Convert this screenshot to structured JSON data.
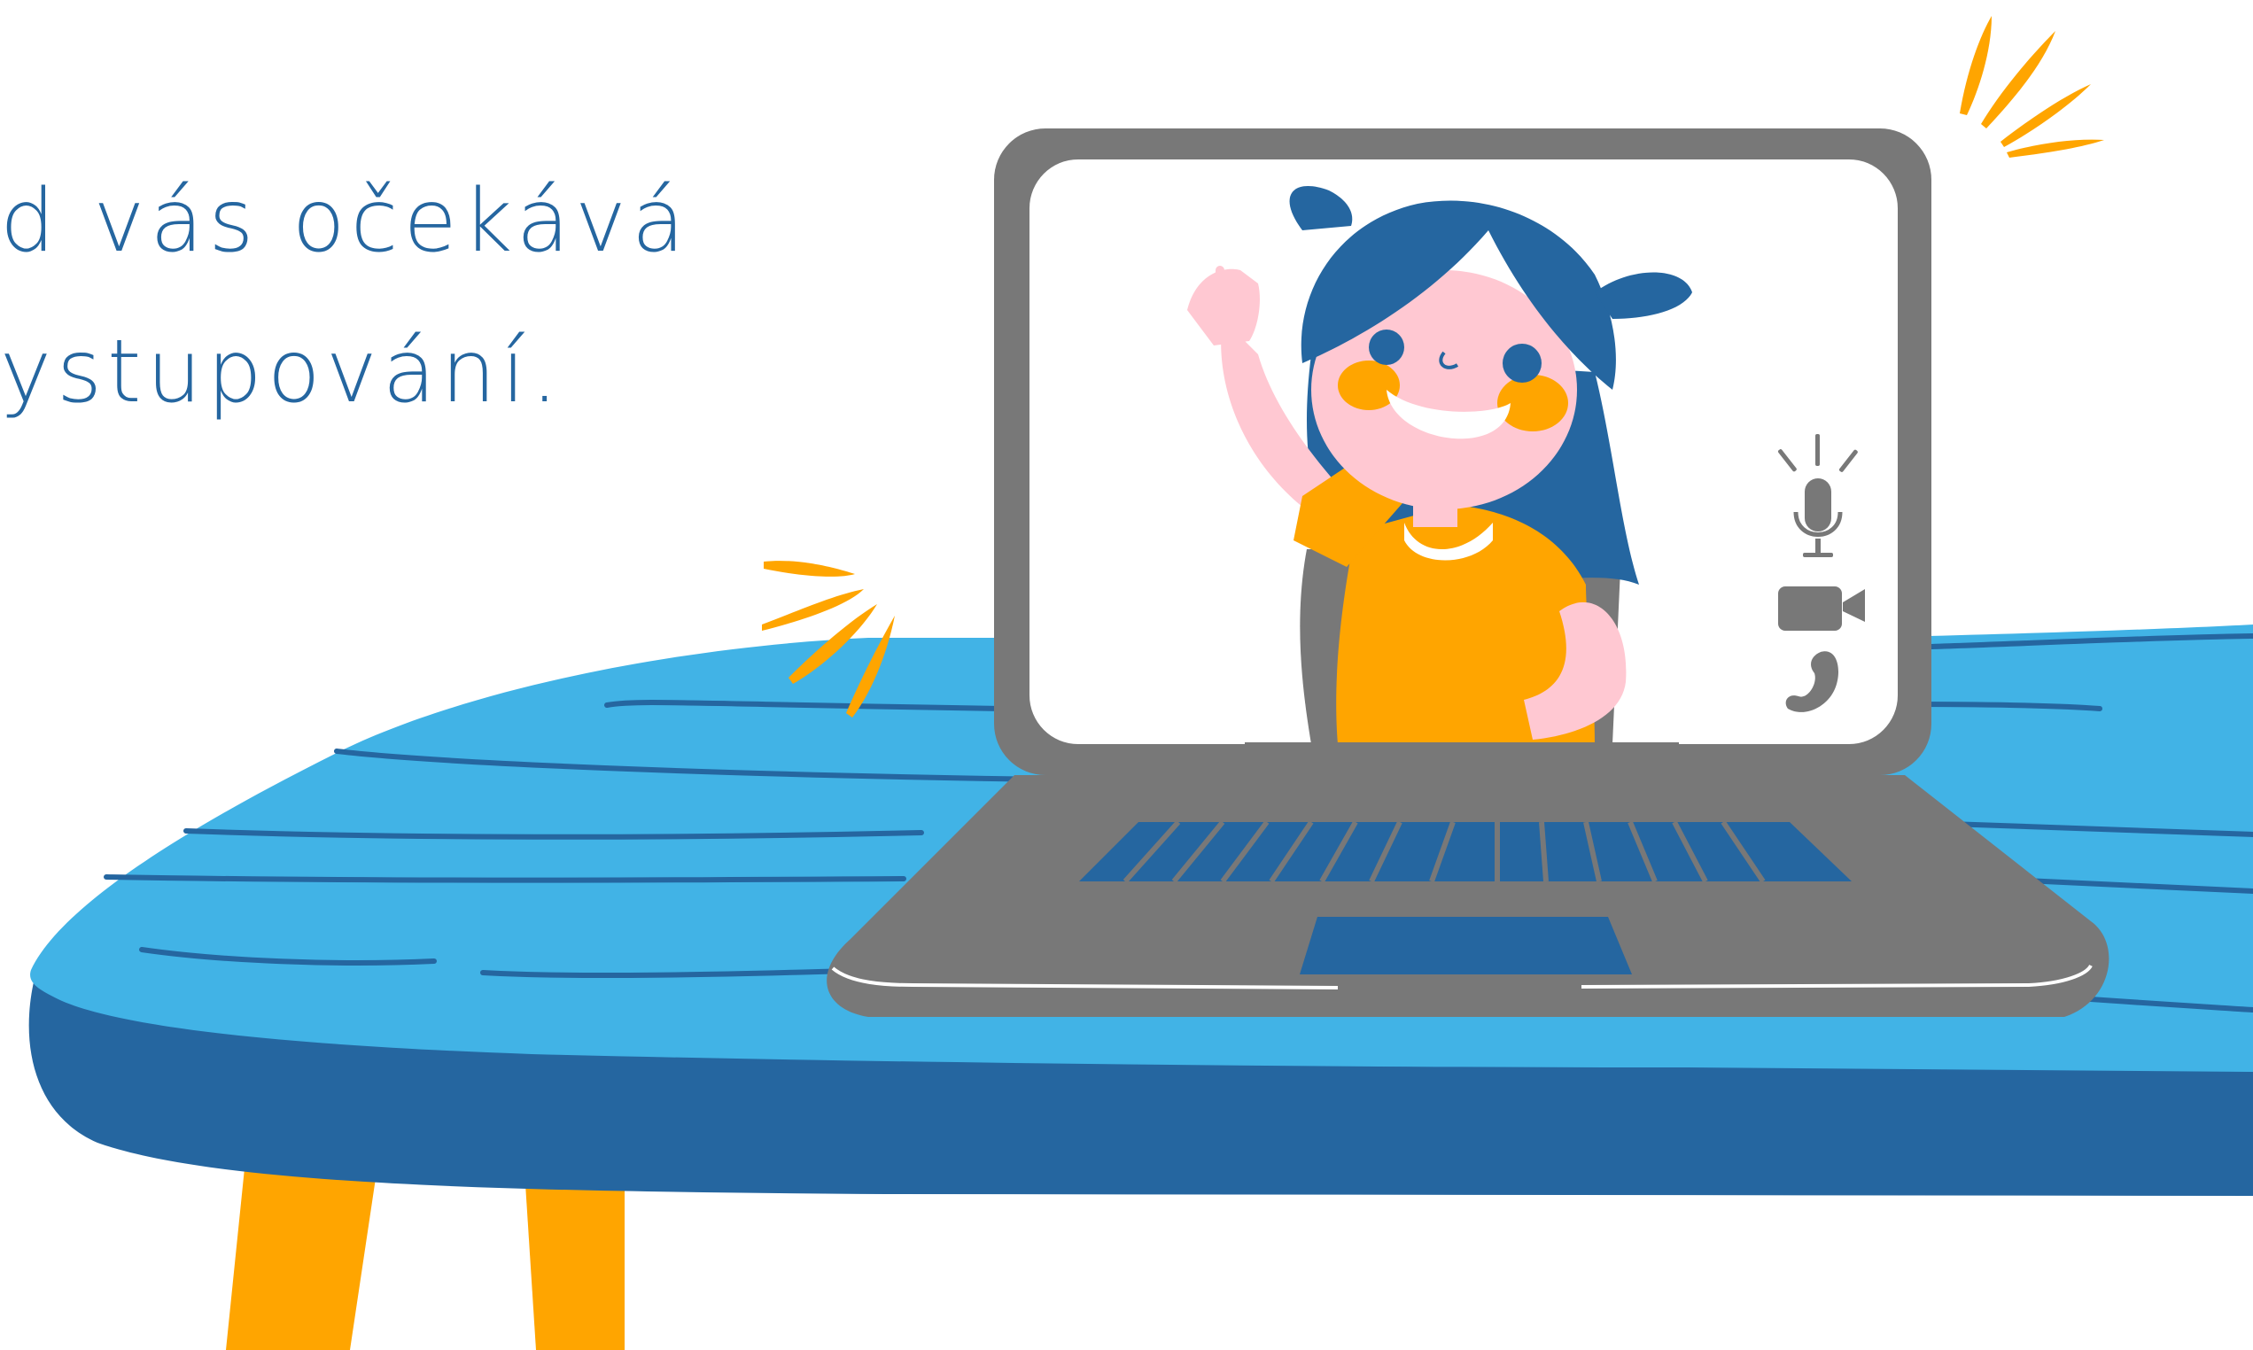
{
  "headline": {
    "line1": "d vás očekává",
    "line2": "ystupování."
  },
  "colors": {
    "text": "#2566a0",
    "table_top": "#41b3e6",
    "table_side": "#2566a0",
    "table_legs": "#ffa500",
    "laptop": "#787878",
    "screen": "#ffffff",
    "hair": "#2566a0",
    "skin": "#ffc8d2",
    "shirt": "#ffa500",
    "sparkle": "#ffa500"
  },
  "icons": [
    "microphone-icon",
    "video-camera-icon",
    "phone-icon"
  ]
}
